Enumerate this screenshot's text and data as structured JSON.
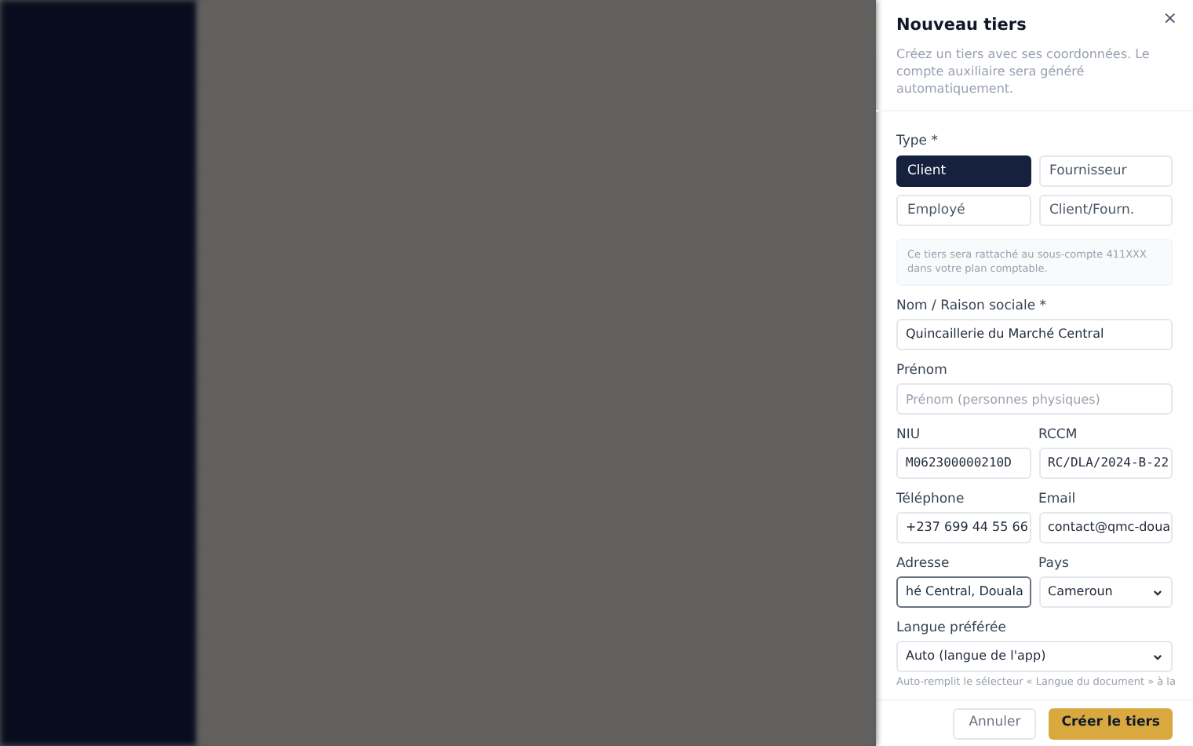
{
  "drawer": {
    "title": "Nouveau tiers",
    "description": "Créez un tiers avec ses coordonnées. Le compte auxiliaire sera généré automatiquement.",
    "close": "×",
    "type_label": "Type *",
    "types": [
      {
        "label": "Client",
        "selected": true
      },
      {
        "label": "Fournisseur",
        "selected": false
      },
      {
        "label": "Employé",
        "selected": false
      },
      {
        "label": "Client/Fourn.",
        "selected": false
      }
    ],
    "info": "Ce tiers sera rattaché au sous-compte 411XXX dans votre plan comptable.",
    "fields": [
      {
        "kind": "text",
        "label": "Nom / Raison sociale *",
        "value": "Quincaillerie du Marché Central"
      },
      {
        "kind": "text",
        "label": "Prénom",
        "placeholder": "Prénom (personnes physiques)"
      },
      {
        "kind": "pair",
        "items": [
          {
            "kind": "mono",
            "label": "NIU",
            "value": "M062300000210D"
          },
          {
            "kind": "mono",
            "label": "RCCM",
            "value": "RC/DLA/2024-B-22"
          }
        ]
      },
      {
        "kind": "pair",
        "items": [
          {
            "kind": "text",
            "label": "Téléphone",
            "value": "+237 699 44 55 66"
          },
          {
            "kind": "text",
            "label": "Email",
            "value": "contact@qmc-doua"
          }
        ]
      },
      {
        "kind": "pair",
        "items": [
          {
            "kind": "focused",
            "label": "Adresse",
            "value": "hé Central, Douala"
          },
          {
            "kind": "select",
            "label": "Pays",
            "value": "Cameroun"
          }
        ]
      },
      {
        "kind": "select",
        "label": "Langue préférée",
        "value": "Auto (langue de l'app)",
        "help": "Auto-remplit le sélecteur « Langue du document » à la"
      }
    ],
    "cancel": "Annuler",
    "submit": "Créer le tiers"
  }
}
